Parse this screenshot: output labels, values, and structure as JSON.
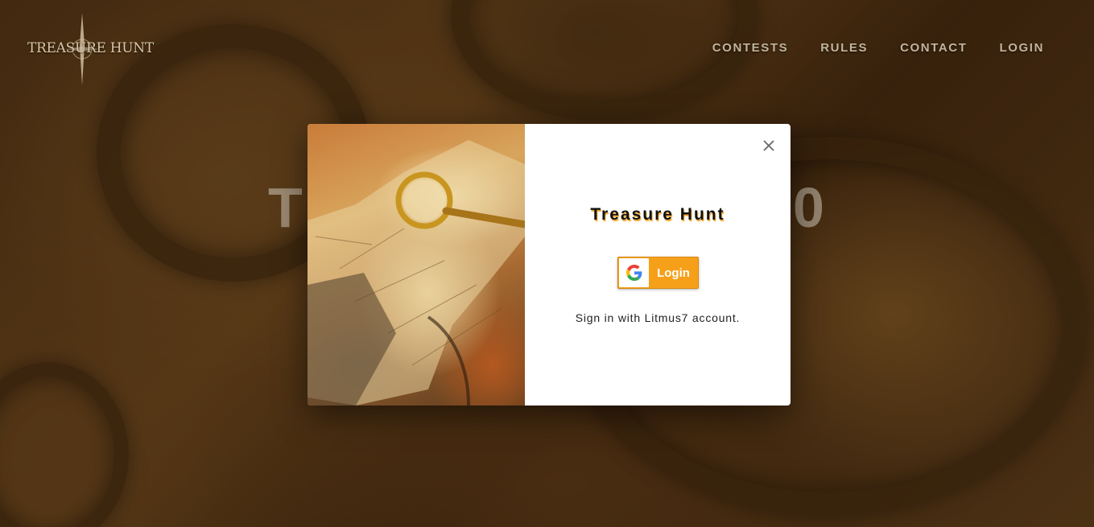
{
  "header": {
    "logo_text": "TREASURE HUNT",
    "nav": [
      "CONTESTS",
      "RULES",
      "CONTACT",
      "LOGIN"
    ]
  },
  "hero": {
    "left_fragment": "T",
    "right_fragment": "0"
  },
  "modal": {
    "title": "Treasure Hunt",
    "login_button_label": "Login",
    "sign_in_text": "Sign in with Litmus7 account."
  },
  "colors": {
    "accent": "#f6a01a",
    "nav_text": "#c2b59d",
    "title_shadow": "#f0a21e"
  }
}
